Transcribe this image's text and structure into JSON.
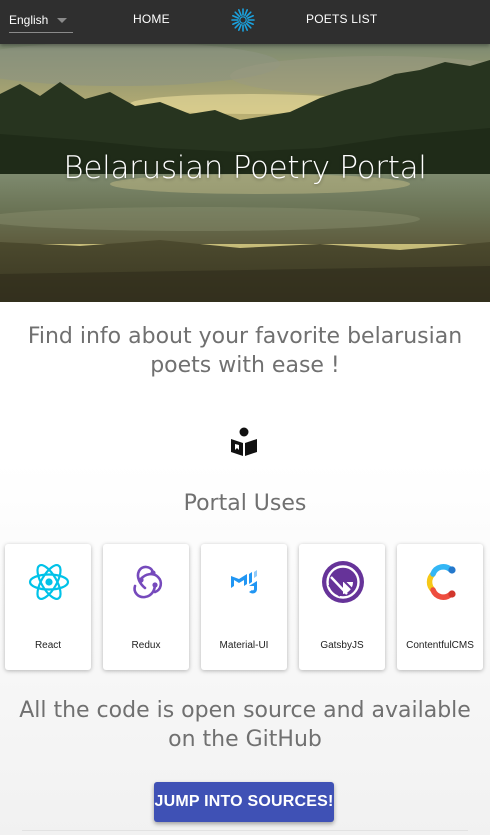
{
  "nav": {
    "language": "English",
    "home_label": "HOME",
    "poets_label": "POETS LIST",
    "logo_icon": "sunburst-logo-icon"
  },
  "hero": {
    "title": "Belarusian Poetry Portal"
  },
  "main": {
    "tagline": "Find info about your favorite belarusian poets with ease !",
    "book_icon": "book-reader-icon",
    "uses_title": "Portal Uses",
    "technologies": [
      {
        "label": "React",
        "icon": "react-icon",
        "color": "#00c2e8"
      },
      {
        "label": "Redux",
        "icon": "redux-icon",
        "color": "#764abc"
      },
      {
        "label": "Material-UI",
        "icon": "material-ui-icon",
        "color": "#2196f3"
      },
      {
        "label": "GatsbyJS",
        "icon": "gatsby-icon",
        "color": "#663399"
      },
      {
        "label": "ContentfulCMS",
        "icon": "contentful-icon",
        "color": "#2478cc"
      }
    ],
    "open_source_text": "All the code is open source and available on the GitHub",
    "button_label": "JUMP INTO SOURCES!"
  },
  "colors": {
    "navbar": "#2f2f2f",
    "accent": "#3f51b5",
    "text_gray": "#707070"
  }
}
